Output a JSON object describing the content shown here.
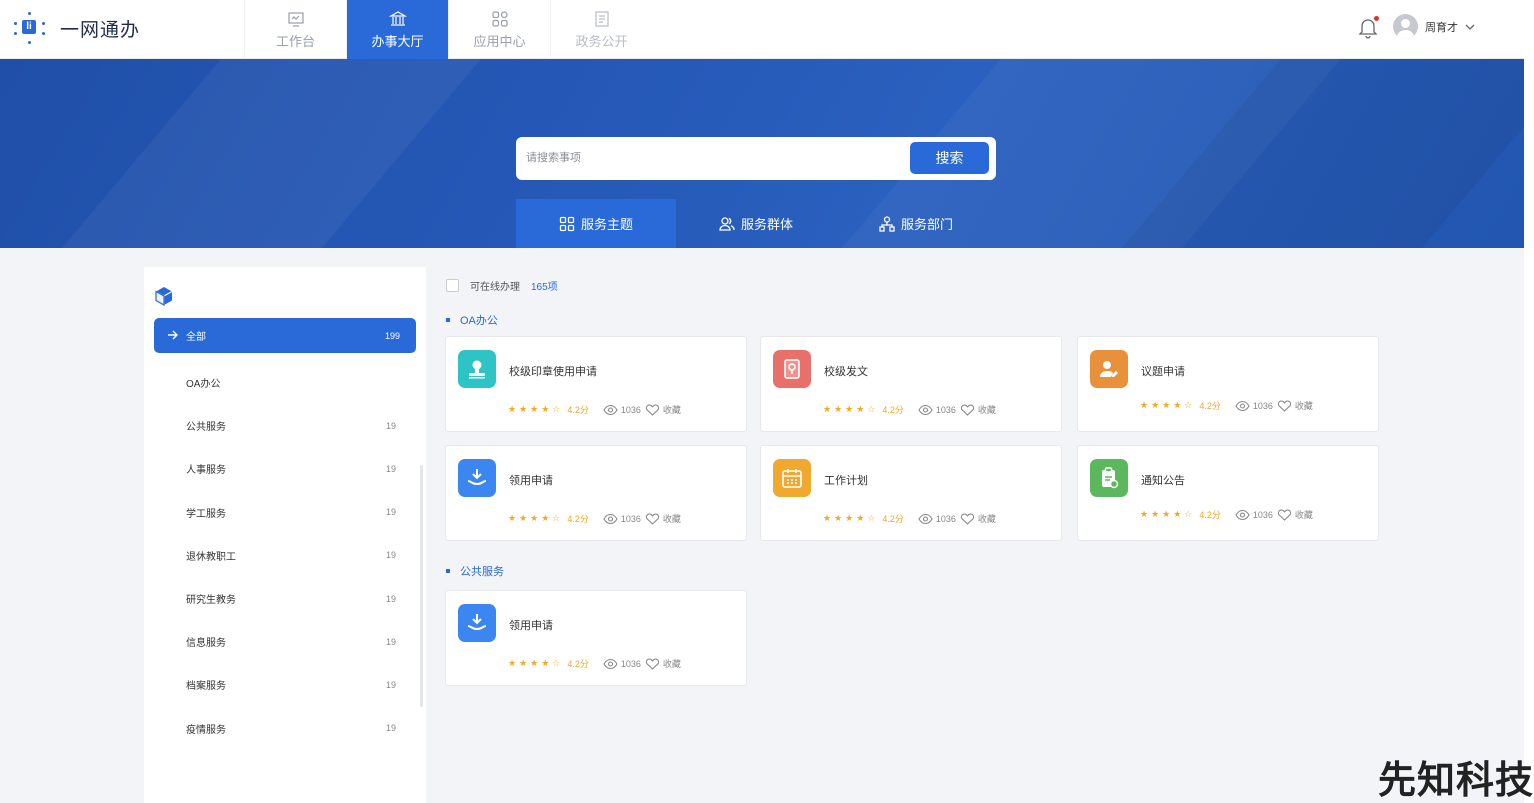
{
  "app": {
    "title": "一网通办"
  },
  "topnav": [
    {
      "label": "工作台",
      "icon": "monitor-icon"
    },
    {
      "label": "办事大厅",
      "icon": "bank-icon"
    },
    {
      "label": "应用中心",
      "icon": "apps-icon"
    },
    {
      "label": "政务公开",
      "icon": "document-icon"
    }
  ],
  "user": {
    "name": "周育才"
  },
  "search": {
    "placeholder": "请搜索事项",
    "button": "搜索"
  },
  "service_tabs": [
    {
      "label": "服务主题",
      "icon": "grid-icon"
    },
    {
      "label": "服务群体",
      "icon": "users-icon"
    },
    {
      "label": "服务部门",
      "icon": "org-icon"
    }
  ],
  "sidebar": {
    "items": [
      {
        "label": "全部",
        "count": "199"
      },
      {
        "label": "OA办公",
        "count": ""
      },
      {
        "label": "公共服务",
        "count": "19"
      },
      {
        "label": "人事服务",
        "count": "19"
      },
      {
        "label": "学工服务",
        "count": "19"
      },
      {
        "label": "退休教职工",
        "count": "19"
      },
      {
        "label": "研究生教务",
        "count": "19"
      },
      {
        "label": "信息服务",
        "count": "19"
      },
      {
        "label": "档案服务",
        "count": "19"
      },
      {
        "label": "疫情服务",
        "count": "19"
      }
    ]
  },
  "filter": {
    "label": "可在线办理",
    "count": "165项"
  },
  "sections": [
    {
      "title": "OA办公",
      "cards": [
        {
          "title": "校级印章使用申请",
          "rating": "4.2分",
          "views": "1036",
          "fav": "收藏",
          "color": "#2ec4c6",
          "icon": "stamp-icon"
        },
        {
          "title": "校级发文",
          "rating": "4.2分",
          "views": "1036",
          "fav": "收藏",
          "color": "#e8706b",
          "icon": "document-icon"
        },
        {
          "title": "议题申请",
          "rating": "4.2分",
          "views": "1036",
          "fav": "收藏",
          "color": "#e8913a",
          "icon": "user-edit-icon"
        },
        {
          "title": "领用申请",
          "rating": "4.2分",
          "views": "1036",
          "fav": "收藏",
          "color": "#3b86f0",
          "icon": "download-hand-icon"
        },
        {
          "title": "工作计划",
          "rating": "4.2分",
          "views": "1036",
          "fav": "收藏",
          "color": "#f0a92e",
          "icon": "calendar-icon"
        },
        {
          "title": "通知公告",
          "rating": "4.2分",
          "views": "1036",
          "fav": "收藏",
          "color": "#5cb85c",
          "icon": "clipboard-icon"
        }
      ]
    },
    {
      "title": "公共服务",
      "cards": [
        {
          "title": "领用申请",
          "rating": "4.2分",
          "views": "1036",
          "fav": "收藏",
          "color": "#3b86f0",
          "icon": "download-hand-icon"
        }
      ]
    }
  ],
  "watermark": "先知科技",
  "colors": {
    "primary": "#2a6ad8",
    "star": "#f5a623"
  }
}
